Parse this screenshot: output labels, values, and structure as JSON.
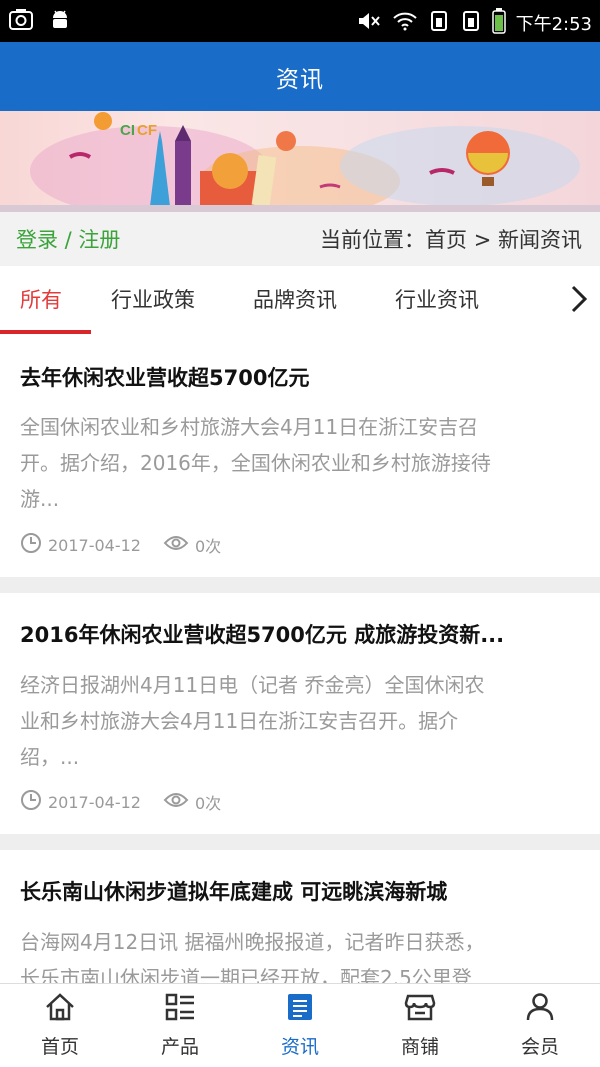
{
  "status": {
    "time": "下午2:53"
  },
  "header": {
    "title": "资讯"
  },
  "nav": {
    "login": "登录 / 注册",
    "location_label": "当前位置：首页 > 新闻资讯"
  },
  "tabs": [
    {
      "label": "所有"
    },
    {
      "label": "行业政策"
    },
    {
      "label": "品牌资讯"
    },
    {
      "label": "行业资讯"
    }
  ],
  "articles": [
    {
      "title": "去年休闲农业营收超5700亿元",
      "summary_lines": [
        "全国休闲农业和乡村旅游大会4月11日在浙江安吉召",
        "开。据介绍，2016年，全国休闲农业和乡村旅游接待",
        "游..."
      ],
      "date": "2017-04-12",
      "views": "0次"
    },
    {
      "title": "2016年休闲农业营收超5700亿元 成旅游投资新...",
      "summary_lines": [
        "经济日报湖州4月11日电（记者 乔金亮）全国休闲农",
        "业和乡村旅游大会4月11日在浙江安吉召开。据介",
        "绍，..."
      ],
      "date": "2017-04-12",
      "views": "0次"
    },
    {
      "title": "长乐南山休闲步道拟年底建成 可远眺滨海新城",
      "summary_lines": [
        "台海网4月12日讯 据福州晚报报道，记者昨日获悉，",
        "长乐市南山休闲步道一期已经开放，配套2.5公里登"
      ]
    }
  ],
  "bottom_nav": [
    {
      "label": "首页",
      "icon": "home-icon"
    },
    {
      "label": "产品",
      "icon": "grid-list-icon"
    },
    {
      "label": "资讯",
      "icon": "news-icon"
    },
    {
      "label": "商铺",
      "icon": "store-icon"
    },
    {
      "label": "会员",
      "icon": "user-icon"
    }
  ],
  "colors": {
    "primary": "#1a6cc9",
    "active_tab": "#e23b3b",
    "login": "#3aa33a"
  }
}
